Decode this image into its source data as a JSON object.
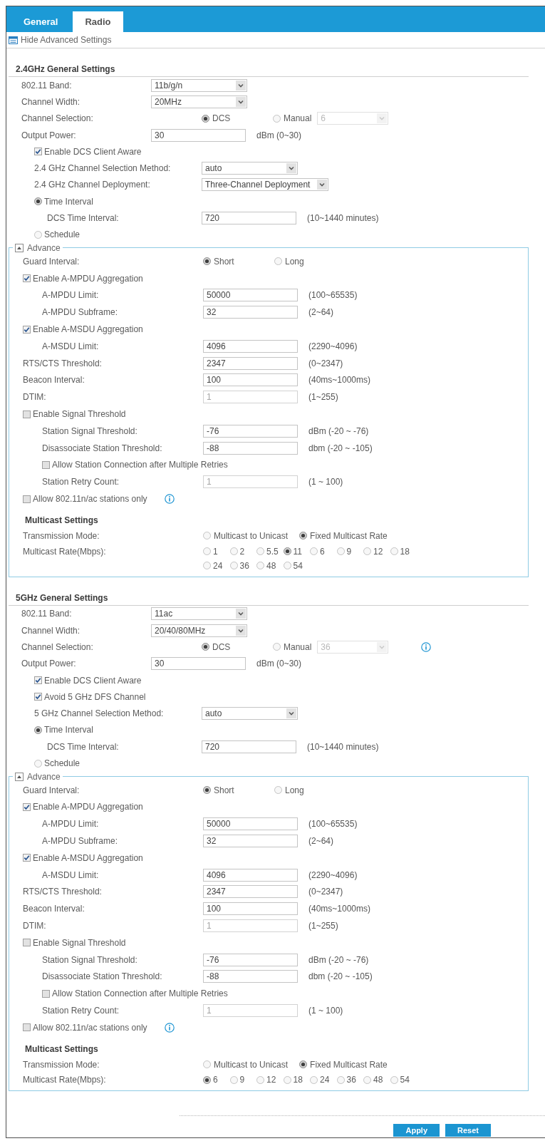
{
  "tabs": [
    {
      "label": "General",
      "selected": false
    },
    {
      "label": "Radio",
      "selected": true
    }
  ],
  "advanced_toggle": {
    "label": "Hide Advanced Settings"
  },
  "sections": [
    {
      "title": "2.4GHz General Settings",
      "rows": [
        {
          "kind": "select",
          "label": "802.11 Band:",
          "value": "11b/g/n",
          "disabled": false
        },
        {
          "kind": "select",
          "label": "Channel Width:",
          "value": "20MHz",
          "disabled": false
        },
        {
          "kind": "radio_group",
          "label": "Channel Selection:",
          "options": [
            {
              "label": "DCS",
              "selected": true
            },
            {
              "label": "Manual",
              "selected": false,
              "select": {
                "value": "6",
                "disabled": true
              }
            }
          ]
        },
        {
          "kind": "input",
          "label": "Output Power:",
          "value": "30",
          "note": "dBm (0~30)",
          "disabled": false
        },
        {
          "kind": "group",
          "children": [
            {
              "kind": "checkbox",
              "label": "Enable DCS Client Aware",
              "checked": true
            },
            {
              "kind": "select",
              "label": "2.4 GHz Channel Selection Method:",
              "value": "auto",
              "disabled": false
            },
            {
              "kind": "select",
              "label": "2.4 GHz Channel Deployment:",
              "value": "Three-Channel Deployment",
              "disabled": false
            },
            {
              "kind": "radio",
              "label": "Time Interval",
              "selected": true,
              "children": [
                {
                  "kind": "input",
                  "label": "DCS Time Interval:",
                  "value": "720",
                  "note": "(10~1440 minutes)",
                  "disabled": false
                }
              ]
            },
            {
              "kind": "radio",
              "label": "Schedule",
              "selected": false
            }
          ]
        }
      ],
      "advance": {
        "legend": "Advance",
        "expanded": true,
        "rows": [
          {
            "kind": "radio_group",
            "label": "Guard Interval:",
            "options": [
              {
                "label": "Short",
                "selected": true
              },
              {
                "label": "Long",
                "selected": false
              }
            ]
          },
          {
            "kind": "checkbox",
            "label": "Enable A-MPDU Aggregation",
            "checked": true,
            "children": [
              {
                "kind": "input",
                "label": "A-MPDU Limit:",
                "value": "50000",
                "note": "(100~65535)",
                "disabled": false
              },
              {
                "kind": "input",
                "label": "A-MPDU Subframe:",
                "value": "32",
                "note": "(2~64)",
                "disabled": false
              }
            ]
          },
          {
            "kind": "checkbox",
            "label": "Enable A-MSDU Aggregation",
            "checked": true,
            "children": [
              {
                "kind": "input",
                "label": "A-MSDU Limit:",
                "value": "4096",
                "note": "(2290~4096)",
                "disabled": false
              }
            ]
          },
          {
            "kind": "input",
            "label": "RTS/CTS Threshold:",
            "value": "2347",
            "note": "(0~2347)",
            "disabled": false
          },
          {
            "kind": "input",
            "label": "Beacon Interval:",
            "value": "100",
            "note": "(40ms~1000ms)",
            "disabled": false
          },
          {
            "kind": "input",
            "label": "DTIM:",
            "value": "1",
            "note": "(1~255)",
            "disabled": true
          },
          {
            "kind": "checkbox",
            "label": "Enable Signal Threshold",
            "checked": false,
            "children": [
              {
                "kind": "input",
                "label": "Station Signal Threshold:",
                "value": "-76",
                "note": "dBm (-20 ~ -76)",
                "disabled": false
              },
              {
                "kind": "input",
                "label": "Disassociate Station Threshold:",
                "value": "-88",
                "note": "dbm (-20 ~ -105)",
                "disabled": false
              },
              {
                "kind": "checkbox",
                "label": "Allow Station Connection after Multiple Retries",
                "checked": false
              },
              {
                "kind": "input",
                "label": "Station Retry Count:",
                "value": "1",
                "note": "(1 ~ 100)",
                "disabled": true
              }
            ]
          },
          {
            "kind": "checkbox",
            "label": "Allow 802.11n/ac stations only",
            "checked": false,
            "info": true
          },
          {
            "kind": "heading",
            "label": "Multicast Settings"
          },
          {
            "kind": "radio_group",
            "label": "Transmission Mode:",
            "options": [
              {
                "label": "Multicast to Unicast",
                "selected": false
              },
              {
                "label": "Fixed Multicast Rate",
                "selected": true
              }
            ]
          },
          {
            "kind": "rate_group",
            "label": "Multicast Rate(Mbps):",
            "options": [
              {
                "label": "1",
                "selected": false
              },
              {
                "label": "2",
                "selected": false
              },
              {
                "label": "5.5",
                "selected": false
              },
              {
                "label": "11",
                "selected": true
              },
              {
                "label": "6",
                "selected": false
              },
              {
                "label": "9",
                "selected": false
              },
              {
                "label": "12",
                "selected": false
              },
              {
                "label": "18",
                "selected": false
              },
              {
                "label": "24",
                "selected": false
              },
              {
                "label": "36",
                "selected": false
              },
              {
                "label": "48",
                "selected": false
              },
              {
                "label": "54",
                "selected": false
              }
            ]
          }
        ]
      }
    },
    {
      "title": "5GHz General Settings",
      "rows": [
        {
          "kind": "select",
          "label": "802.11 Band:",
          "value": "11ac",
          "disabled": false
        },
        {
          "kind": "select",
          "label": "Channel Width:",
          "value": "20/40/80MHz",
          "disabled": false
        },
        {
          "kind": "radio_group",
          "label": "Channel Selection:",
          "info": true,
          "options": [
            {
              "label": "DCS",
              "selected": true
            },
            {
              "label": "Manual",
              "selected": false,
              "select": {
                "value": "36",
                "disabled": true
              }
            }
          ]
        },
        {
          "kind": "input",
          "label": "Output Power:",
          "value": "30",
          "note": "dBm (0~30)",
          "disabled": false
        },
        {
          "kind": "group",
          "children": [
            {
              "kind": "checkbox",
              "label": "Enable DCS Client Aware",
              "checked": true
            },
            {
              "kind": "checkbox",
              "label": "Avoid 5 GHz DFS Channel",
              "checked": true
            },
            {
              "kind": "select",
              "label": "5 GHz Channel Selection Method:",
              "value": "auto",
              "disabled": false
            },
            {
              "kind": "radio",
              "label": "Time Interval",
              "selected": true,
              "children": [
                {
                  "kind": "input",
                  "label": "DCS Time Interval:",
                  "value": "720",
                  "note": "(10~1440 minutes)",
                  "disabled": false
                }
              ]
            },
            {
              "kind": "radio",
              "label": "Schedule",
              "selected": false
            }
          ]
        }
      ],
      "advance": {
        "legend": "Advance",
        "expanded": true,
        "rows": [
          {
            "kind": "radio_group",
            "label": "Guard Interval:",
            "options": [
              {
                "label": "Short",
                "selected": true
              },
              {
                "label": "Long",
                "selected": false
              }
            ]
          },
          {
            "kind": "checkbox",
            "label": "Enable A-MPDU Aggregation",
            "checked": true,
            "children": [
              {
                "kind": "input",
                "label": "A-MPDU Limit:",
                "value": "50000",
                "note": "(100~65535)",
                "disabled": false
              },
              {
                "kind": "input",
                "label": "A-MPDU Subframe:",
                "value": "32",
                "note": "(2~64)",
                "disabled": false
              }
            ]
          },
          {
            "kind": "checkbox",
            "label": "Enable A-MSDU Aggregation",
            "checked": true,
            "children": [
              {
                "kind": "input",
                "label": "A-MSDU Limit:",
                "value": "4096",
                "note": "(2290~4096)",
                "disabled": false
              }
            ]
          },
          {
            "kind": "input",
            "label": "RTS/CTS Threshold:",
            "value": "2347",
            "note": "(0~2347)",
            "disabled": false
          },
          {
            "kind": "input",
            "label": "Beacon Interval:",
            "value": "100",
            "note": "(40ms~1000ms)",
            "disabled": false
          },
          {
            "kind": "input",
            "label": "DTIM:",
            "value": "1",
            "note": "(1~255)",
            "disabled": true
          },
          {
            "kind": "checkbox",
            "label": "Enable Signal Threshold",
            "checked": false,
            "children": [
              {
                "kind": "input",
                "label": "Station Signal Threshold:",
                "value": "-76",
                "note": "dBm (-20 ~ -76)",
                "disabled": false
              },
              {
                "kind": "input",
                "label": "Disassociate Station Threshold:",
                "value": "-88",
                "note": "dbm (-20 ~ -105)",
                "disabled": false
              },
              {
                "kind": "checkbox",
                "label": "Allow Station Connection after Multiple Retries",
                "checked": false
              },
              {
                "kind": "input",
                "label": "Station Retry Count:",
                "value": "1",
                "note": "(1 ~ 100)",
                "disabled": true
              }
            ]
          },
          {
            "kind": "checkbox",
            "label": "Allow 802.11n/ac stations only",
            "checked": false,
            "info": true
          },
          {
            "kind": "heading",
            "label": "Multicast Settings"
          },
          {
            "kind": "radio_group",
            "label": "Transmission Mode:",
            "options": [
              {
                "label": "Multicast to Unicast",
                "selected": false
              },
              {
                "label": "Fixed Multicast Rate",
                "selected": true
              }
            ]
          },
          {
            "kind": "rate_group",
            "label": "Multicast Rate(Mbps):",
            "options": [
              {
                "label": "6",
                "selected": true
              },
              {
                "label": "9",
                "selected": false
              },
              {
                "label": "12",
                "selected": false
              },
              {
                "label": "18",
                "selected": false
              },
              {
                "label": "24",
                "selected": false
              },
              {
                "label": "36",
                "selected": false
              },
              {
                "label": "48",
                "selected": false
              },
              {
                "label": "54",
                "selected": false
              }
            ]
          }
        ]
      }
    }
  ],
  "buttons": [
    {
      "label": "Apply"
    },
    {
      "label": "Reset"
    }
  ]
}
